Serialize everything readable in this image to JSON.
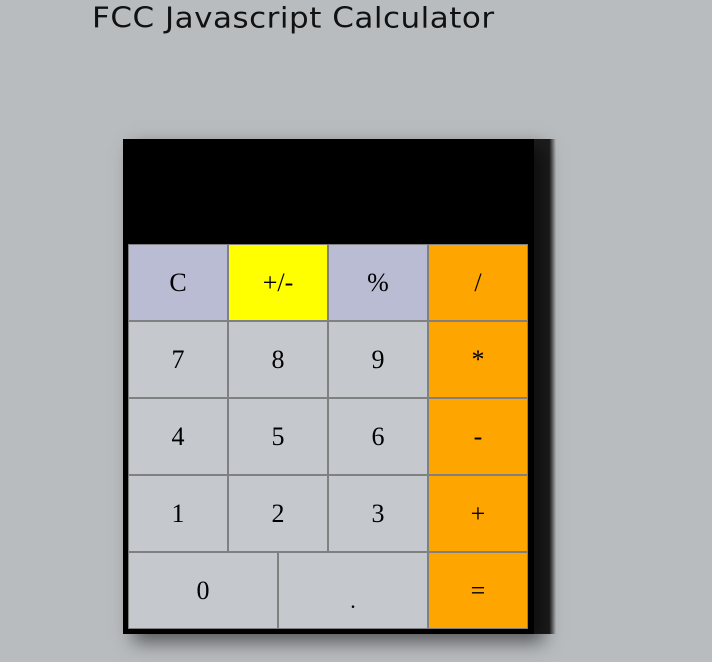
{
  "page": {
    "title": "FCC Javascript Calculator"
  },
  "calculator": {
    "display": {
      "value": ""
    },
    "keys": {
      "row1": [
        "C",
        "+/-",
        "%",
        "/"
      ],
      "row2": [
        "7",
        "8",
        "9",
        "*"
      ],
      "row3": [
        "4",
        "5",
        "6",
        "-"
      ],
      "row4": [
        "1",
        "2",
        "3",
        "+"
      ],
      "row5": [
        "0",
        ".",
        "="
      ]
    },
    "colors": {
      "background": "#b9bcbf",
      "key_default": "#c5c9ce",
      "key_function": "#b9bcd3",
      "key_sign": "#ffff00",
      "key_operator": "#ffa500",
      "display": "#000000"
    }
  }
}
